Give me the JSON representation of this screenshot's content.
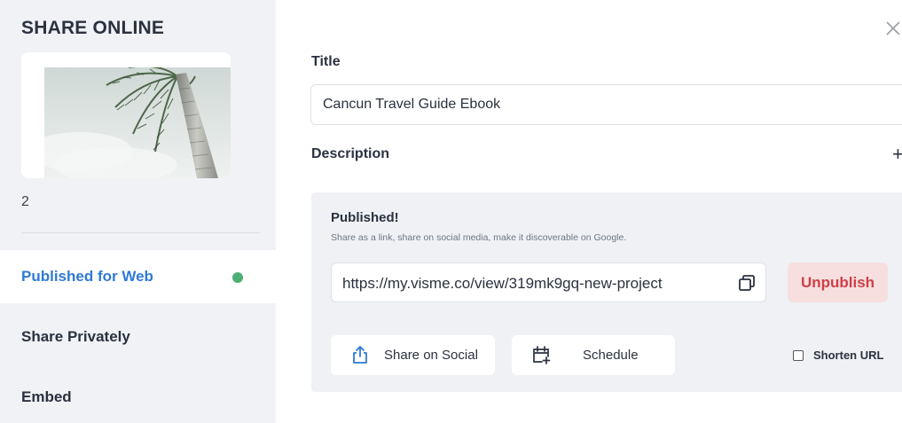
{
  "sidebar": {
    "title": "SHARE ONLINE",
    "page_count": "2",
    "items": [
      {
        "label": "Published for Web",
        "active": true,
        "status": "published"
      },
      {
        "label": "Share Privately",
        "active": false
      },
      {
        "label": "Embed",
        "active": false
      }
    ]
  },
  "form": {
    "title_label": "Title",
    "title_value": "Cancun Travel Guide Ebook",
    "description_label": "Description",
    "description_toggle": "+"
  },
  "publish": {
    "heading": "Published!",
    "subtext": "Share as a link, share on social media, make it discoverable on Google.",
    "url": "https://my.visme.co/view/319mk9gq-new-project",
    "unpublish_label": "Unpublish",
    "share_social_label": "Share on Social",
    "schedule_label": "Schedule",
    "shorten_url_label": "Shorten URL",
    "shorten_url_checked": false
  },
  "icons": {
    "close": "close-icon",
    "copy": "copy-icon",
    "share": "share-upload-icon",
    "schedule": "calendar-add-icon"
  },
  "colors": {
    "active_nav": "#2f7ad6",
    "status_dot": "#4caf73",
    "unpublish_bg": "#f7dfe0",
    "unpublish_text": "#cf3f46"
  }
}
